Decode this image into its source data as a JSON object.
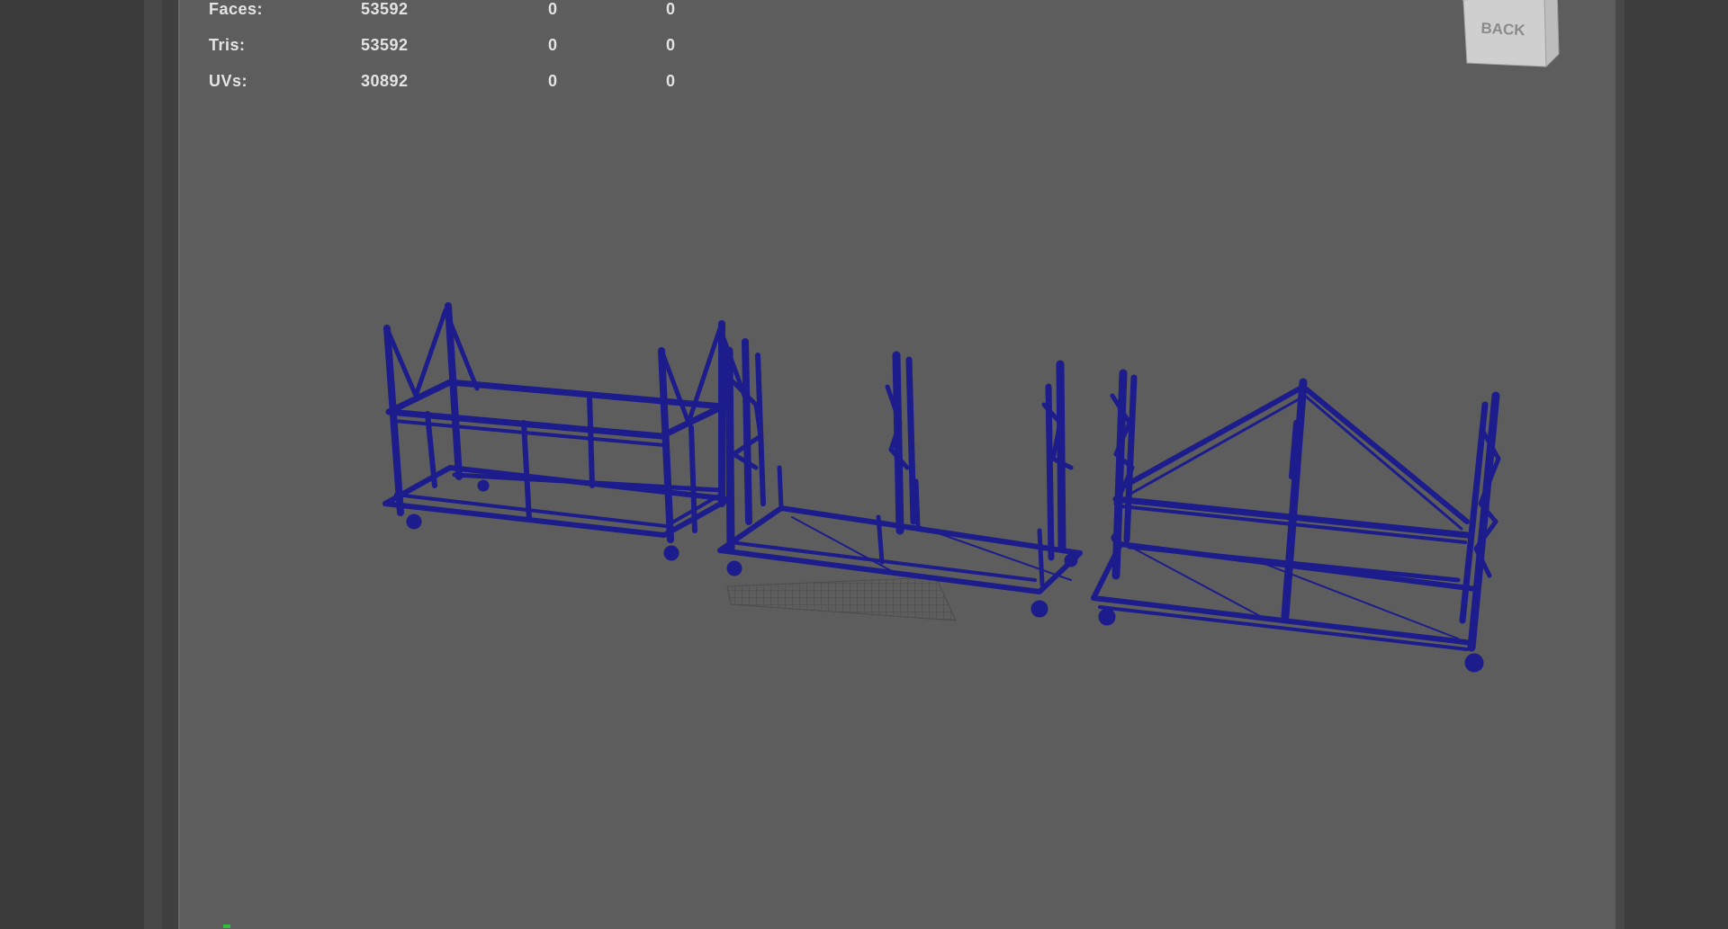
{
  "hud": {
    "rows": [
      {
        "label": "Faces:",
        "c1": "53592",
        "c2": "0",
        "c3": "0"
      },
      {
        "label": "Tris:",
        "c1": "53592",
        "c2": "0",
        "c3": "0"
      },
      {
        "label": "UVs:",
        "c1": "30892",
        "c2": "0",
        "c3": "0"
      }
    ]
  },
  "viewcube": {
    "face_label": "BACK"
  },
  "colors": {
    "viewport_bg": "#5d5d5d",
    "wireframe": "#1c1c8c",
    "hud_text": "#e4e4e4"
  }
}
